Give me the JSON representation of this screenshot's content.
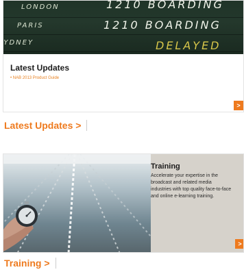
{
  "latest_updates_card": {
    "board": {
      "cities": [
        "LONDON",
        "PARIS",
        "SYDNEY"
      ],
      "statuses": [
        "1210 BOARDING",
        "1210 BOARDING",
        "DELAYED"
      ]
    },
    "heading": "Latest Updates",
    "link": "• NAB 2013 Product Guide",
    "arrow_label": ">"
  },
  "latest_updates_section_label": "Latest Updates >",
  "training_card": {
    "title": "Training",
    "description": "Accelerate your expertise in the broadcast and related media industries with top quality face-to-face and online e-learning training.",
    "arrow_label": ">"
  },
  "training_section_label": "Training >",
  "colors": {
    "accent": "#ee7a1e",
    "board": "#1f3428",
    "training_panel": "#d6d2cb"
  },
  "icons": [
    "chevron-right-icon",
    "stopwatch-icon"
  ]
}
